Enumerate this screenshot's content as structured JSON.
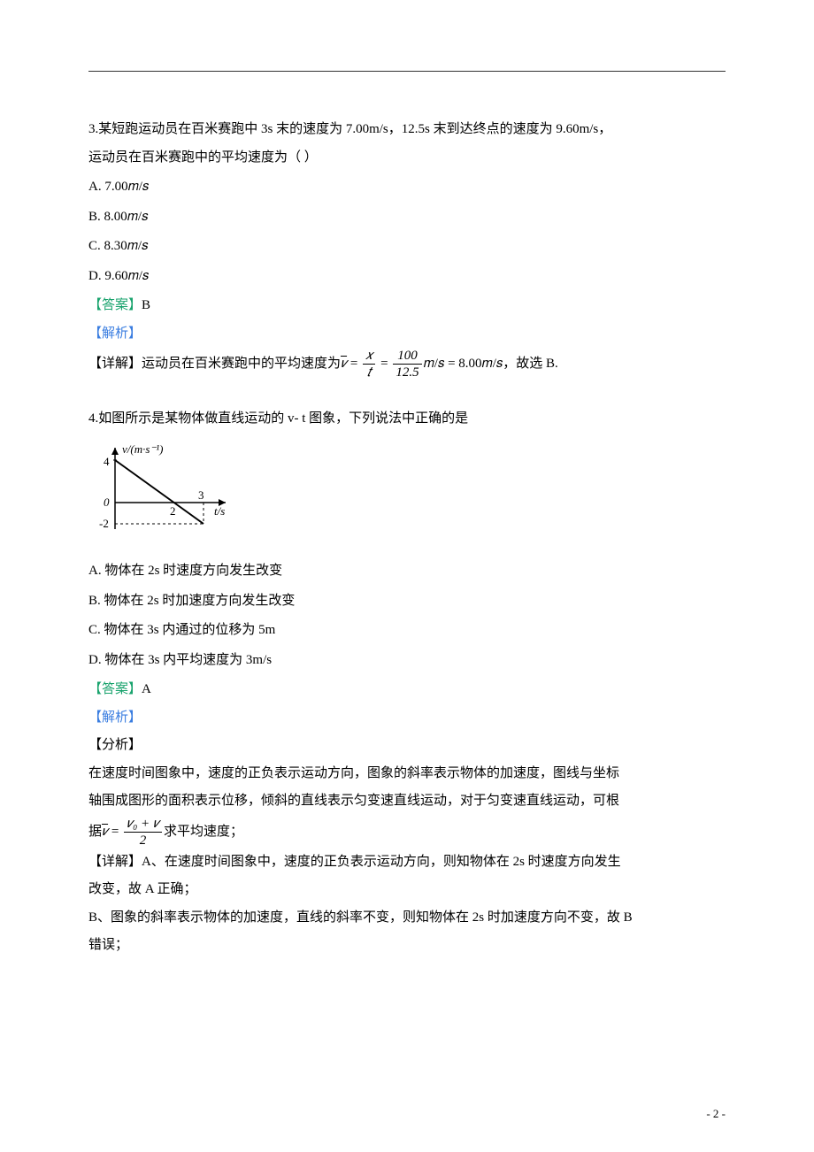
{
  "q3": {
    "stem_line1": "3.某短跑运动员在百米赛跑中 3s 末的速度为 7.00m/s，12.5s 末到达终点的速度为 9.60m/s，",
    "stem_line2": "运动员在百米赛跑中的平均速度为（     ）",
    "optA": "A.  7.00𝑚/𝑠",
    "optB": "B.  8.00𝑚/𝑠",
    "optC": "C.  8.30𝑚/𝑠",
    "optD": "D.  9.60𝑚/𝑠",
    "answer_label": "【答案】",
    "answer_value": "B",
    "analysis_label": "【解析】",
    "detail_prefix": "【详解】运动员在百米赛跑中的平均速度为",
    "frac_num1": "𝑥",
    "frac_den1": "𝑡",
    "frac_num2": "100",
    "frac_den2": "12.5",
    "detail_suffix": "𝑚/𝑠 = 8.00𝑚/𝑠，故选 B."
  },
  "q4": {
    "stem": "4.如图所示是某物体做直线运动的 v- t 图象，下列说法中正确的是",
    "optA": "A.  物体在 2s 时速度方向发生改变",
    "optB": "B.  物体在 2s 时加速度方向发生改变",
    "optC": "C.  物体在 3s 内通过的位移为 5m",
    "optD": "D.  物体在 3s 内平均速度为 3m/s",
    "answer_label": "【答案】",
    "answer_value": "A",
    "analysis_label": "【解析】",
    "fenxi_label": "【分析】",
    "fenxi_line1": "在速度时间图象中，速度的正负表示运动方向，图象的斜率表示物体的加速度，图线与坐标",
    "fenxi_line2": "轴围成图形的面积表示位移，倾斜的直线表示匀变速直线运动，对于匀变速直线运动，可根",
    "fenxi_line3_prefix": "据",
    "frac_num": "𝑣₀ + 𝑣",
    "frac_den": "2",
    "fenxi_line3_suffix": "求平均速度；",
    "detail_a1": "【详解】A、在速度时间图象中，速度的正负表示运动方向，则知物体在 2s 时速度方向发生",
    "detail_a2": "改变，故 A 正确；",
    "detail_b1": "B、图象的斜率表示物体的加速度，直线的斜率不变，则知物体在 2s 时加速度方向不变，故 B",
    "detail_b2": "错误；"
  },
  "chart_data": {
    "type": "line",
    "title": "",
    "xlabel": "t/s",
    "ylabel": "v/(m·s⁻¹)",
    "series": [
      {
        "name": "velocity",
        "x": [
          0,
          2,
          3
        ],
        "y": [
          4,
          0,
          -2
        ]
      }
    ],
    "xlim": [
      0,
      3.5
    ],
    "ylim": [
      -2,
      4
    ],
    "yticks": [
      -2,
      0,
      4
    ],
    "xticks": [
      0,
      2,
      3
    ]
  },
  "page_number": "- 2 -"
}
